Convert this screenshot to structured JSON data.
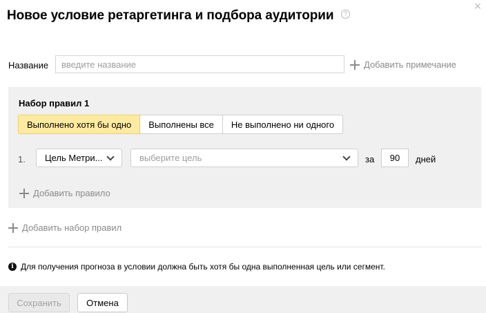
{
  "dialog": {
    "title": "Новое условие ретаргетинга и подбора аудитории",
    "help_icon": "?",
    "close_icon": "×"
  },
  "name_field": {
    "label": "Название",
    "placeholder": "введите название",
    "value": "",
    "add_note_label": "Добавить примечание"
  },
  "ruleset": {
    "title": "Набор правил 1",
    "segments": [
      {
        "label": "Выполнено хотя бы одно",
        "active": true
      },
      {
        "label": "Выполнены все",
        "active": false
      },
      {
        "label": "Не выполнено ни одного",
        "active": false
      }
    ],
    "rules": [
      {
        "number": "1.",
        "goal_type": "Цель Метри...",
        "target_placeholder": "выберите цель",
        "period_prefix": "за",
        "days": "90",
        "days_label": "дней"
      }
    ],
    "add_rule_label": "Добавить правило"
  },
  "add_ruleset_label": "Добавить набор правил",
  "info_text": "Для получения прогноза в условии должна быть хотя бы одна выполненная цель или сегмент.",
  "footer": {
    "save_label": "Сохранить",
    "cancel_label": "Отмена"
  },
  "colors": {
    "active_segment": "#ffeba0",
    "panel_bg": "#f0f0f0",
    "muted_text": "#8a8a8a"
  }
}
